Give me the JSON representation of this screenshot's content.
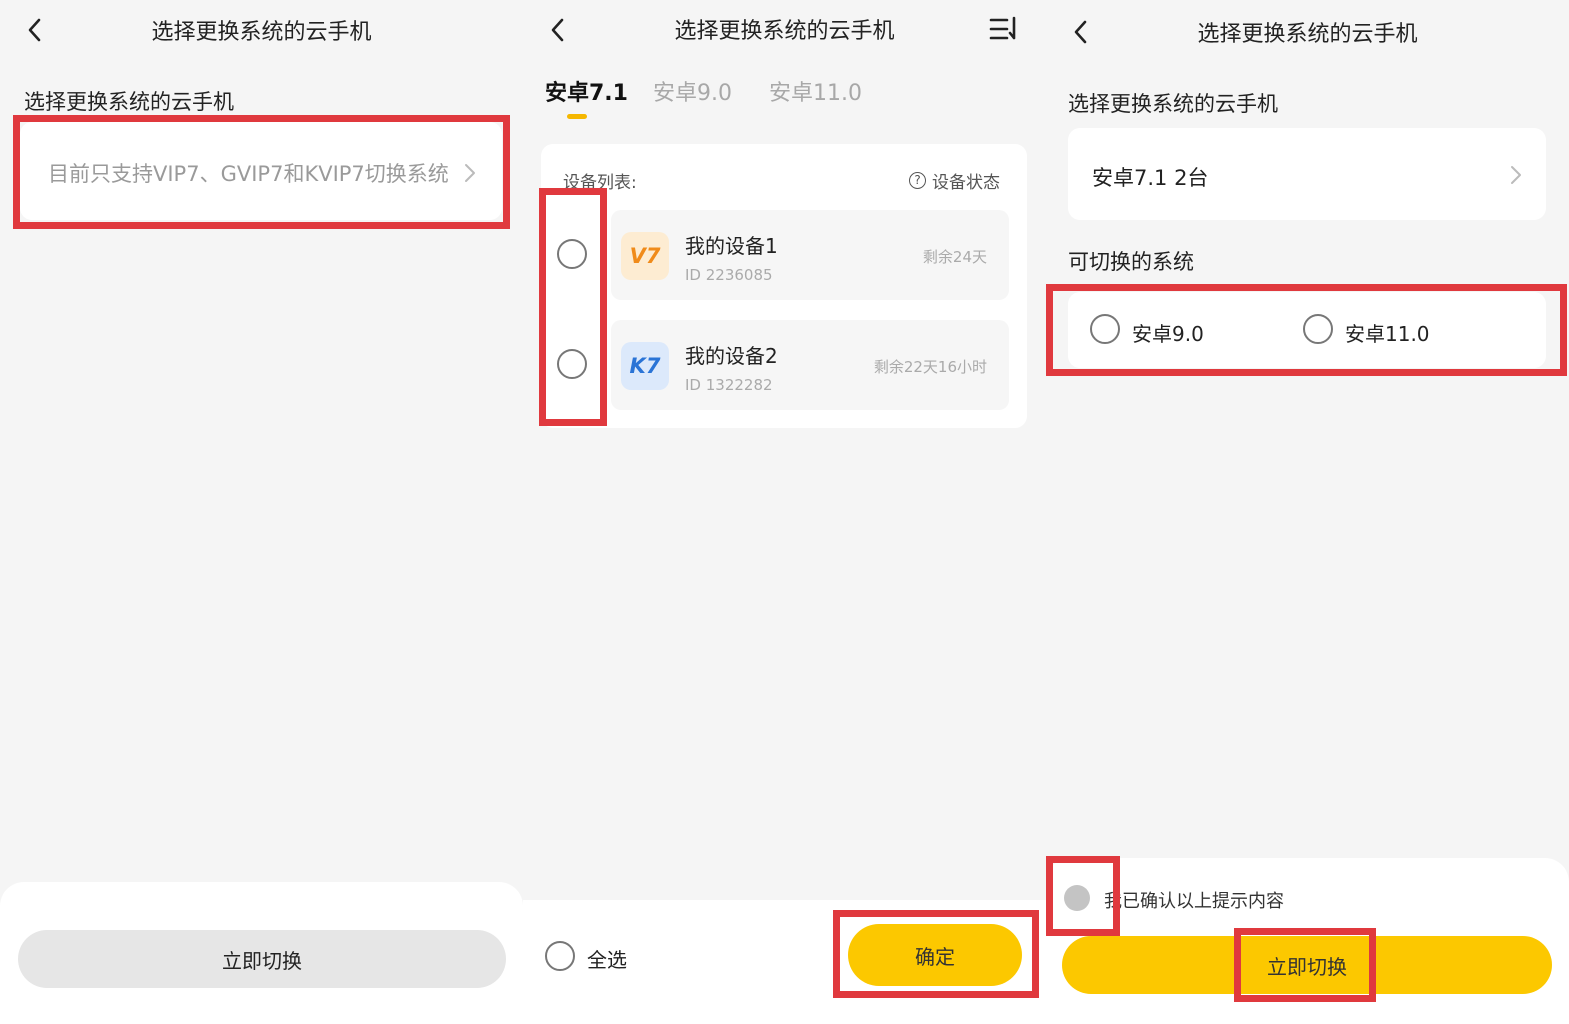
{
  "panel1": {
    "title": "选择更换系统的云手机",
    "section_label": "选择更换系统的云手机",
    "select_placeholder": "目前只支持VIP7、GVIP7和KVIP7切换系统",
    "switch_button": "立即切换"
  },
  "panel2": {
    "title": "选择更换系统的云手机",
    "tabs": [
      {
        "label": "安卓7.1",
        "active": true
      },
      {
        "label": "安卓9.0",
        "active": false
      },
      {
        "label": "安卓11.0",
        "active": false
      }
    ],
    "list_label": "设备列表:",
    "status_link": "设备状态",
    "devices": [
      {
        "logo": "V7",
        "name": "我的设备1",
        "id": "ID 2236085",
        "remaining": "剩余24天"
      },
      {
        "logo": "K7",
        "name": "我的设备2",
        "id": "ID 1322282",
        "remaining": "剩余22天16小时"
      }
    ],
    "select_all": "全选",
    "confirm_button": "确定"
  },
  "panel3": {
    "title": "选择更换系统的云手机",
    "section_label": "选择更换系统的云手机",
    "selected_value": "安卓7.1 2台",
    "switchable_label": "可切换的系统",
    "options": [
      "安卓9.0",
      "安卓11.0"
    ],
    "confirm_text": "我已确认以上提示内容",
    "switch_button": "立即切换"
  },
  "colors": {
    "accent": "#fcc800",
    "highlight_red": "#e0393e",
    "tab_underline": "#f5b700"
  }
}
